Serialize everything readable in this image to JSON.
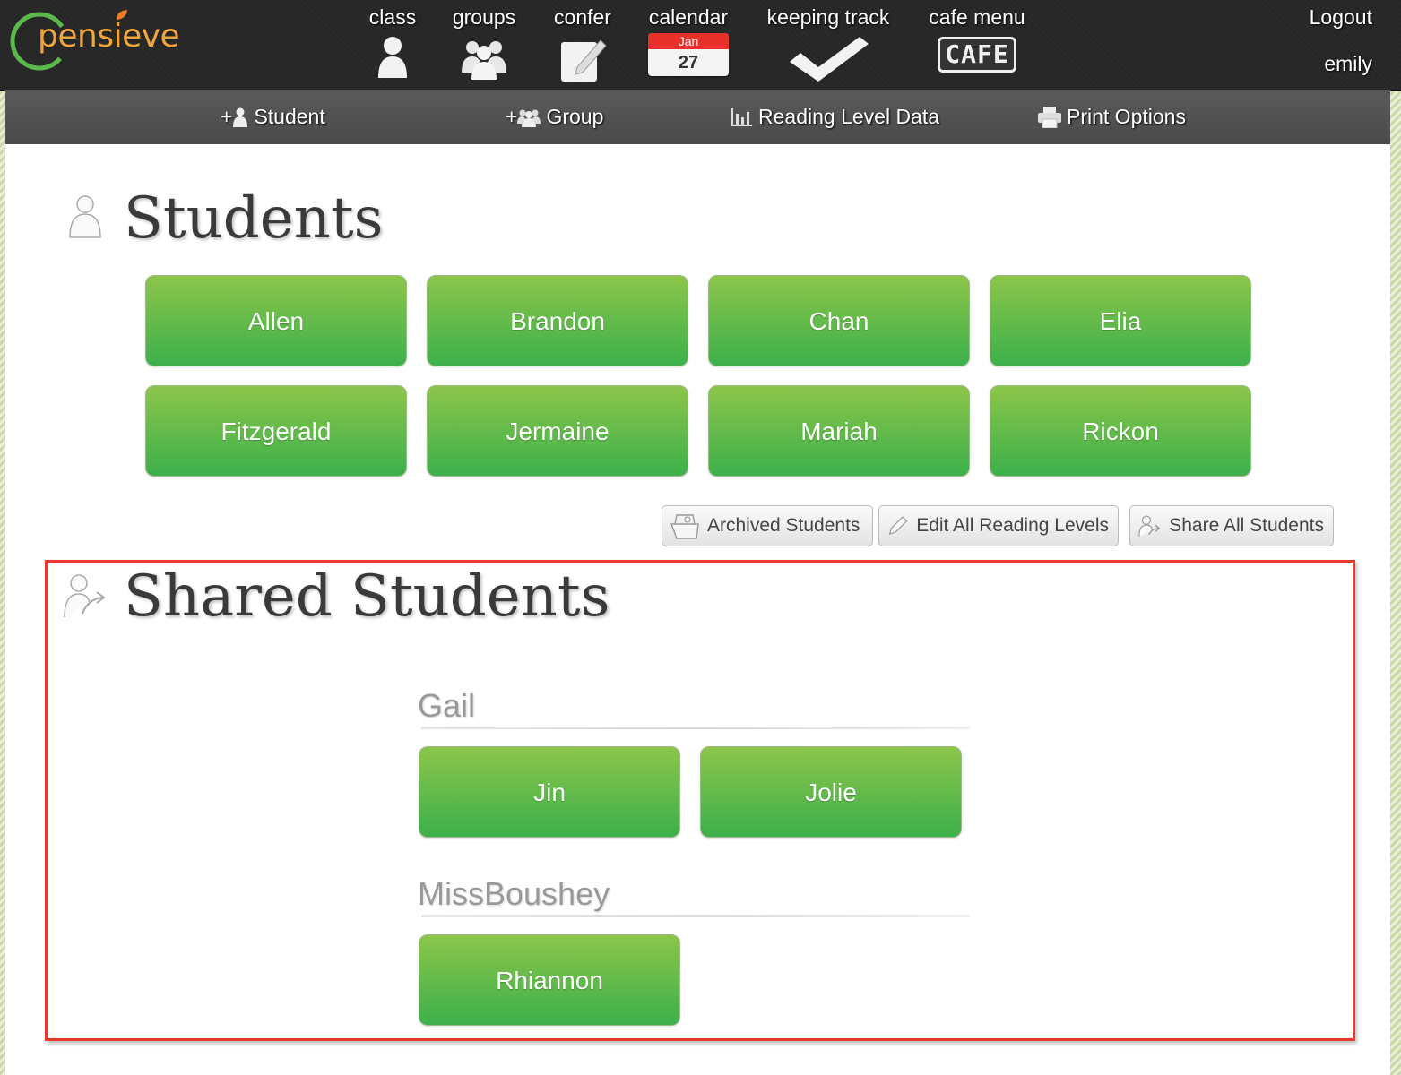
{
  "brand": {
    "name": "pensieve",
    "colors": {
      "orange": "#f0a53a",
      "green": "#5ab94a"
    }
  },
  "nav": {
    "items": [
      {
        "label": "class",
        "icon": "person-icon"
      },
      {
        "label": "groups",
        "icon": "group-icon"
      },
      {
        "label": "confer",
        "icon": "notepad-pencil-icon"
      },
      {
        "label": "calendar",
        "icon": "calendar-icon",
        "month": "Jan",
        "day": "27"
      },
      {
        "label": "keeping track",
        "icon": "checkmark-icon"
      },
      {
        "label": "cafe menu",
        "icon": "cafe-icon",
        "badge": "CAFE"
      }
    ],
    "logout": "Logout",
    "user": "emily"
  },
  "subnav": {
    "add_student": {
      "prefix": "+",
      "label": "Student"
    },
    "add_group": {
      "prefix": "+",
      "label": "Group"
    },
    "reading_level": "Reading Level Data",
    "print": "Print Options"
  },
  "students": {
    "title": "Students",
    "names": [
      "Allen",
      "Brandon",
      "Chan",
      "Elia",
      "Fitzgerald",
      "Jermaine",
      "Mariah",
      "Rickon"
    ]
  },
  "tools": {
    "archived": "Archived Students",
    "edit_levels": "Edit All Reading Levels",
    "share_all": "Share All Students"
  },
  "shared": {
    "title": "Shared Students",
    "groups": [
      {
        "owner": "Gail",
        "students": [
          "Jin",
          "Jolie"
        ]
      },
      {
        "owner": "MissBoushey",
        "students": [
          "Rhiannon"
        ]
      }
    ]
  },
  "colors": {
    "button_top": "#8cc54a",
    "button_bottom": "#3cb04b",
    "highlight": "#e8392a",
    "topbar": "#2a2a2a"
  }
}
